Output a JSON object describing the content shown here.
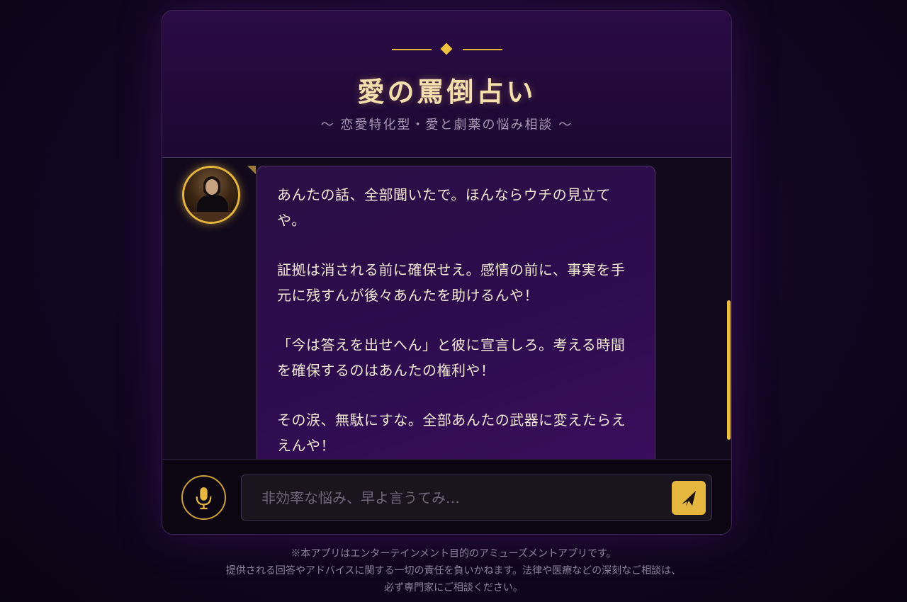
{
  "header": {
    "title": "愛の罵倒占い",
    "subtitle": "〜 恋愛特化型・愛と劇薬の悩み相談 〜"
  },
  "chat": {
    "messages": [
      {
        "sender": "assistant",
        "avatar_icon": "fortune-teller-avatar",
        "paragraphs": [
          "あんたの話、全部聞いたで。ほんならウチの見立てや。",
          "証拠は消される前に確保せえ。感情の前に、事実を手元に残すんが後々あんたを助けるんや！",
          "「今は答えを出せへん」と彼に宣言しろ。考える時間を確保するのはあんたの権利や！",
          "その涙、無駄にすな。全部あんたの武器に変えたらええんや！"
        ]
      }
    ]
  },
  "input": {
    "placeholder": "非効率な悩み、早よ言うてみ…",
    "mic_icon": "microphone-icon",
    "send_icon": "send-icon"
  },
  "disclaimer": {
    "line1": "※本アプリはエンターテインメント目的のアミューズメントアプリです。",
    "line2": "提供される回答やアドバイスに関する一切の責任を負いかねます。法律や医療などの深刻なご相談は、",
    "line3": "必ず専門家にご相談ください。"
  },
  "colors": {
    "accent_gold": "#e6b73e",
    "header_bg": "#2a0b45",
    "bubble_bg": "#2d0b4d",
    "text_cream": "#f3e8d6"
  }
}
